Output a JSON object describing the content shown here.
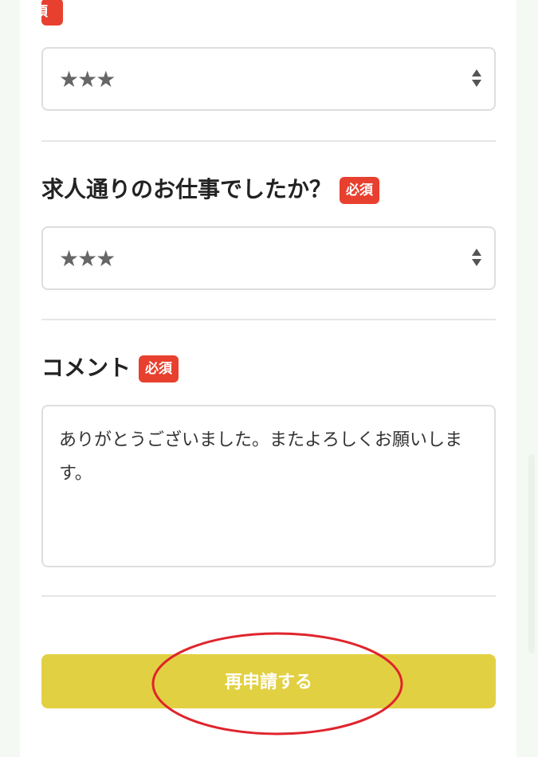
{
  "form": {
    "required_badge": "必須",
    "top_required_fragment": "須",
    "field1": {
      "selected": "★★★"
    },
    "field2": {
      "question": "求人通りのお仕事でしたか？",
      "selected": "★★★"
    },
    "comment": {
      "label": "コメント",
      "value": "ありがとうございました。またよろしくお願いします。"
    },
    "submit_label": "再申請する"
  },
  "colors": {
    "required_badge": "#e8402f",
    "submit_button": "#e2d043",
    "annotation_circle": "#e0242c"
  }
}
